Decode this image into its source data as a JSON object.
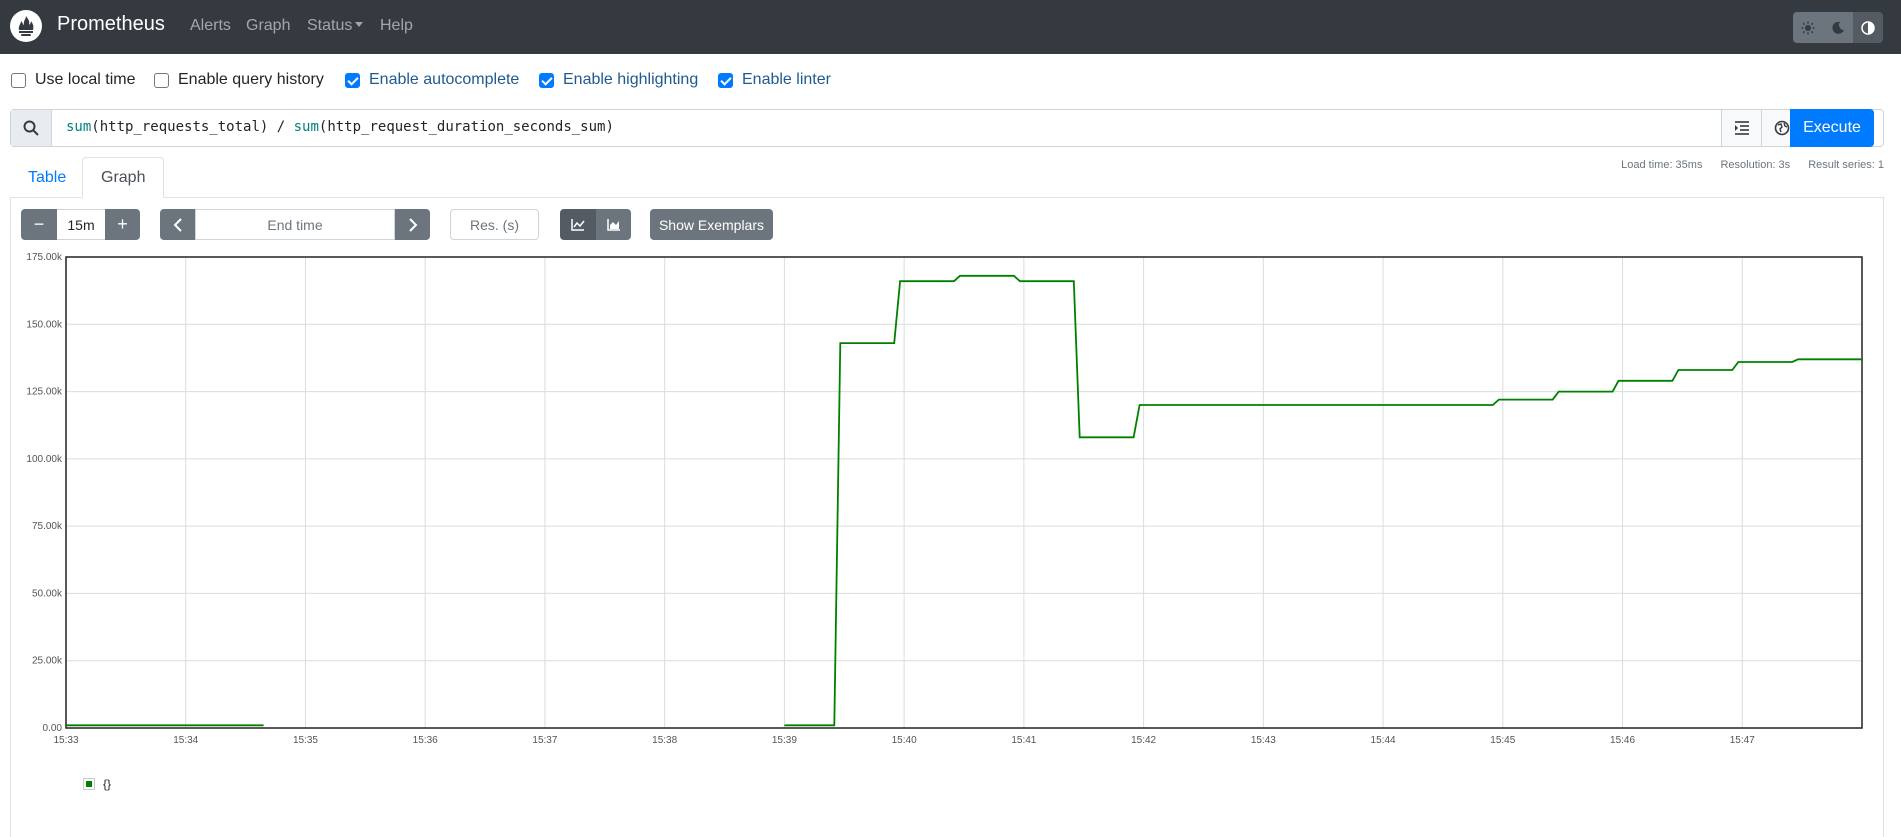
{
  "navbar": {
    "brand": "Prometheus",
    "links": [
      "Alerts",
      "Graph",
      "Status",
      "Help"
    ],
    "theme_icons": [
      "sun-icon",
      "moon-icon",
      "contrast-icon"
    ]
  },
  "options": [
    {
      "label": "Use local time",
      "checked": false
    },
    {
      "label": "Enable query history",
      "checked": false
    },
    {
      "label": "Enable autocomplete",
      "checked": true
    },
    {
      "label": "Enable highlighting",
      "checked": true
    },
    {
      "label": "Enable linter",
      "checked": true
    }
  ],
  "query": {
    "expression": "sum(http_requests_total) / sum(http_request_duration_seconds_sum)",
    "parts": [
      {
        "text": "sum",
        "fn": true
      },
      {
        "text": "(http_requests_total) / ",
        "fn": false
      },
      {
        "text": "sum",
        "fn": true
      },
      {
        "text": "(http_request_duration_seconds_sum)",
        "fn": false
      }
    ],
    "execute_label": "Execute"
  },
  "tabs": {
    "table": "Table",
    "graph": "Graph"
  },
  "stats": {
    "load_time": "Load time: 35ms",
    "resolution": "Resolution: 3s",
    "result_series": "Result series: 1"
  },
  "controls": {
    "minus": "−",
    "plus": "+",
    "range": "15m",
    "end_time_placeholder": "End time",
    "res_placeholder": "Res. (s)",
    "show_exemplars": "Show Exemplars"
  },
  "colors": {
    "series": "#008000",
    "accent": "#007bff",
    "navbar": "#343a40"
  },
  "chart_data": {
    "type": "line",
    "x_ticks": [
      "15:33",
      "15:34",
      "15:35",
      "15:36",
      "15:37",
      "15:38",
      "15:39",
      "15:40",
      "15:41",
      "15:42",
      "15:43",
      "15:44",
      "15:45",
      "15:46",
      "15:47"
    ],
    "y_ticks": [
      "0.00",
      "25.00k",
      "50.00k",
      "75.00k",
      "100.00k",
      "125.00k",
      "150.00k",
      "175.00k"
    ],
    "xlim": [
      "15:33:00",
      "15:48:00"
    ],
    "ylim": [
      0,
      175000
    ],
    "grid": true,
    "legend_position": "bottom-left",
    "series": [
      {
        "name": "{}",
        "color": "#008000",
        "segments": [
          [
            [
              "15:33:00",
              1000
            ],
            [
              "15:34:39",
              1000
            ]
          ],
          [
            [
              "15:39:00",
              1000
            ],
            [
              "15:39:25",
              1000
            ],
            [
              "15:39:28",
              143000
            ],
            [
              "15:39:55",
              143000
            ],
            [
              "15:39:58",
              166000
            ],
            [
              "15:40:25",
              166000
            ],
            [
              "15:40:28",
              168000
            ],
            [
              "15:40:55",
              168000
            ],
            [
              "15:40:58",
              166000
            ],
            [
              "15:41:25",
              166000
            ],
            [
              "15:41:28",
              108000
            ],
            [
              "15:41:55",
              108000
            ],
            [
              "15:41:58",
              120000
            ],
            [
              "15:44:55",
              120000
            ],
            [
              "15:44:58",
              122000
            ],
            [
              "15:45:25",
              122000
            ],
            [
              "15:45:28",
              125000
            ],
            [
              "15:45:55",
              125000
            ],
            [
              "15:45:58",
              129000
            ],
            [
              "15:46:25",
              129000
            ],
            [
              "15:46:28",
              133000
            ],
            [
              "15:46:55",
              133000
            ],
            [
              "15:46:58",
              136000
            ],
            [
              "15:47:25",
              136000
            ],
            [
              "15:47:28",
              137000
            ],
            [
              "15:48:00",
              137000
            ]
          ]
        ]
      }
    ]
  }
}
